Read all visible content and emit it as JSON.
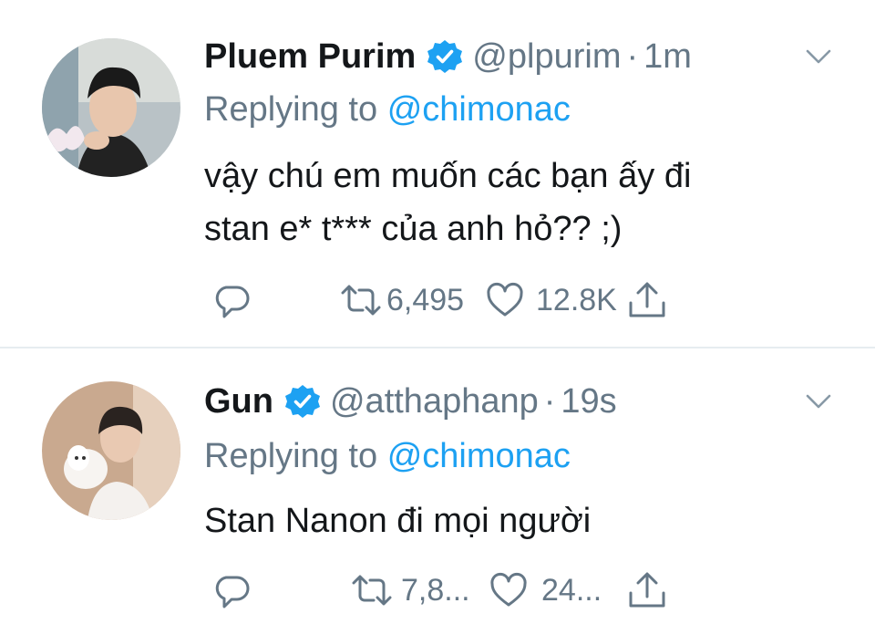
{
  "tweets": [
    {
      "display_name": "Pluem Purim",
      "handle": "@plpurim",
      "separator": "·",
      "time": "1m",
      "replying_prefix": "Replying to",
      "replying_to": "@chimonac",
      "text_lines": [
        "vậy chú em muốn các bạn ấy đi",
        "stan e* t*** của anh hỏ?? ;)"
      ],
      "retweet_count": "6,495",
      "like_count": "12.8K"
    },
    {
      "display_name": "Gun",
      "handle": "@atthaphanp",
      "separator": "·",
      "time": "19s",
      "replying_prefix": "Replying to",
      "replying_to": "@chimonac",
      "text_lines": [
        "Stan Nanon đi mọi người"
      ],
      "retweet_count": "7,8...",
      "like_count": "24..."
    }
  ],
  "colors": {
    "text": "#14171a",
    "secondary": "#657786",
    "link": "#1da1f2",
    "verified": "#1da1f2",
    "divider": "#e6ecf0"
  },
  "icons": [
    "verified-badge-icon",
    "chevron-down-icon",
    "reply-icon",
    "retweet-icon",
    "like-icon",
    "share-icon"
  ]
}
